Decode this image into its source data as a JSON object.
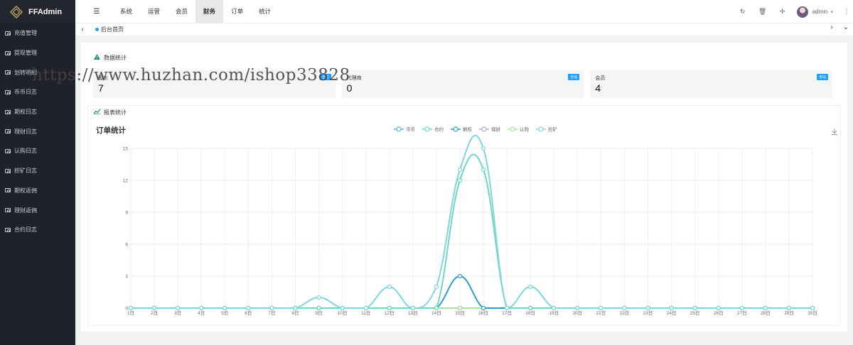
{
  "app": {
    "name": "FFAdmin"
  },
  "sidebar": {
    "items": [
      {
        "label": "充值管理"
      },
      {
        "label": "提现管理"
      },
      {
        "label": "划转明细"
      },
      {
        "label": "币币日志"
      },
      {
        "label": "期权日志"
      },
      {
        "label": "理财日志"
      },
      {
        "label": "认购日志"
      },
      {
        "label": "挖矿日志"
      },
      {
        "label": "期权返佣"
      },
      {
        "label": "理财返佣"
      },
      {
        "label": "合约日志"
      }
    ]
  },
  "topnav": {
    "items": [
      {
        "label": "系统",
        "active": false
      },
      {
        "label": "运营",
        "active": false
      },
      {
        "label": "会员",
        "active": false
      },
      {
        "label": "财务",
        "active": true
      },
      {
        "label": "订单",
        "active": false
      },
      {
        "label": "统计",
        "active": false
      }
    ],
    "user": "admin",
    "icons": [
      "menu-fold-icon",
      "refresh-icon",
      "trash-icon",
      "fullscreen-icon",
      "more-icon"
    ]
  },
  "tabs": {
    "home": "后台首页"
  },
  "stats_section": {
    "title": "数据统计",
    "cards": [
      {
        "label": "股东",
        "value": "7",
        "badge": "全站"
      },
      {
        "label": "代理商",
        "value": "0",
        "badge": "全站"
      },
      {
        "label": "会员",
        "value": "4",
        "badge": "全站"
      }
    ]
  },
  "report_section": {
    "title": "报表统计"
  },
  "watermark": "https://www.huzhan.com/ishop33828",
  "chart_data": {
    "type": "line",
    "title": "订单统计",
    "x": [
      "1日",
      "2日",
      "3日",
      "4日",
      "5日",
      "6日",
      "7日",
      "8日",
      "9日",
      "10日",
      "11日",
      "12日",
      "13日",
      "14日",
      "15日",
      "16日",
      "17日",
      "18日",
      "19日",
      "20日",
      "21日",
      "22日",
      "23日",
      "24日",
      "25日",
      "26日",
      "27日",
      "28日",
      "29日",
      "30日"
    ],
    "ylim": [
      0,
      15
    ],
    "yticks": [
      0,
      3,
      6,
      9,
      12,
      15
    ],
    "grid": true,
    "legend_position": "top",
    "series": [
      {
        "name": "币币",
        "color": "#5ab1ef",
        "values": [
          0,
          0,
          0,
          0,
          0,
          0,
          0,
          0,
          0,
          0,
          0,
          0,
          0,
          0,
          0,
          0,
          0,
          0,
          0,
          0,
          0,
          0,
          0,
          0,
          0,
          0,
          0,
          0,
          0,
          0
        ]
      },
      {
        "name": "合约",
        "color": "#6fd8c0",
        "values": [
          0,
          0,
          0,
          0,
          0,
          0,
          0,
          0,
          0,
          0,
          0,
          0,
          0,
          0,
          12,
          13,
          0,
          0,
          0,
          0,
          0,
          0,
          0,
          0,
          0,
          0,
          0,
          0,
          0,
          0
        ]
      },
      {
        "name": "期权",
        "color": "#2f9fc8",
        "values": [
          0,
          0,
          0,
          0,
          0,
          0,
          0,
          0,
          0,
          0,
          0,
          0,
          0,
          0,
          3,
          0,
          0,
          0,
          0,
          0,
          0,
          0,
          0,
          0,
          0,
          0,
          0,
          0,
          0,
          0
        ]
      },
      {
        "name": "理财",
        "color": "#b6a2de",
        "values": [
          0,
          0,
          0,
          0,
          0,
          0,
          0,
          0,
          0,
          0,
          0,
          0,
          0,
          0,
          0,
          0,
          0,
          0,
          0,
          0,
          0,
          0,
          0,
          0,
          0,
          0,
          0,
          0,
          0,
          0
        ]
      },
      {
        "name": "认购",
        "color": "#a8e6a0",
        "values": [
          0,
          0,
          0,
          0,
          0,
          0,
          0,
          0,
          0,
          0,
          0,
          0,
          0,
          0,
          0,
          0,
          0,
          0,
          0,
          0,
          0,
          0,
          0,
          0,
          0,
          0,
          0,
          0,
          0,
          0
        ]
      },
      {
        "name": "挖矿",
        "color": "#7ed6df",
        "values": [
          0,
          0,
          0,
          0,
          0,
          0,
          0,
          0,
          1,
          0,
          0,
          2,
          0,
          2,
          13,
          15,
          0,
          2,
          0,
          0,
          0,
          0,
          0,
          0,
          0,
          0,
          0,
          0,
          0,
          0
        ]
      }
    ]
  }
}
